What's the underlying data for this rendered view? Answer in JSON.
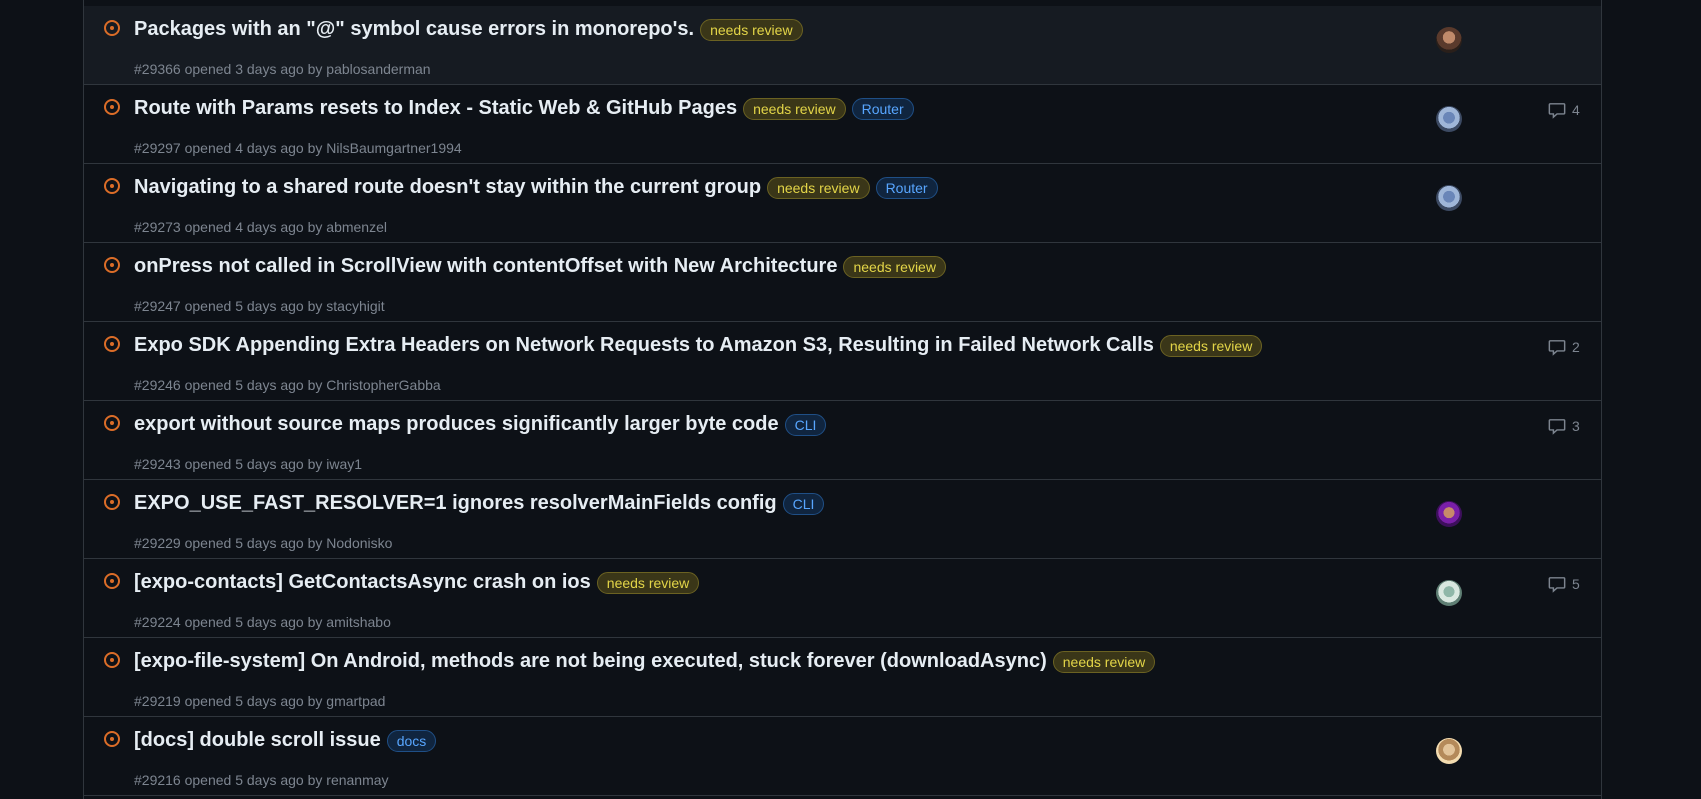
{
  "colors": {
    "background": "#0d1117",
    "row_hover": "#161b22",
    "border": "#30363d",
    "open_icon": "#db6d28",
    "muted_text": "#7d8590"
  },
  "labels": {
    "needs review": {
      "text": "needs review",
      "fg": "#e3d548",
      "bg": "#3a3618",
      "border": "#6b6222"
    },
    "Router": {
      "text": "Router",
      "fg": "#58a6ff",
      "bg": "#10253f",
      "border": "#1f4f86"
    },
    "CLI": {
      "text": "CLI",
      "fg": "#58a6ff",
      "bg": "#10253f",
      "border": "#1f4f86"
    },
    "docs": {
      "text": "docs",
      "fg": "#58a6ff",
      "bg": "#10253f",
      "border": "#1f4f86"
    }
  },
  "issues": [
    {
      "title": "Packages with an \"@\" symbol cause errors in monorepo's.",
      "labels": [
        "needs review"
      ],
      "meta_prefix": "#29366 opened 3 days ago by ",
      "author": "pablosanderman",
      "assignee_avatar": "avatar-photo-1",
      "comments": "",
      "highlight": true
    },
    {
      "title": "Route with Params resets to Index - Static Web & GitHub Pages",
      "labels": [
        "needs review",
        "Router"
      ],
      "meta_prefix": "#29297 opened 4 days ago by ",
      "author": "NilsBaumgartner1994",
      "assignee_avatar": "avatar-photo-2",
      "comments": "4"
    },
    {
      "title": "Navigating to a shared route doesn't stay within the current group",
      "labels": [
        "needs review",
        "Router"
      ],
      "meta_prefix": "#29273 opened 4 days ago by ",
      "author": "abmenzel",
      "assignee_avatar": "avatar-photo-2",
      "comments": ""
    },
    {
      "title": "onPress not called in ScrollView with contentOffset with New Architecture",
      "labels": [
        "needs review"
      ],
      "meta_prefix": "#29247 opened 5 days ago by ",
      "author": "stacyhigit",
      "assignee_avatar": "",
      "comments": ""
    },
    {
      "title": "Expo SDK Appending Extra Headers on Network Requests to Amazon S3, Resulting in Failed Network Calls",
      "labels": [
        "needs review"
      ],
      "meta_prefix": "#29246 opened 5 days ago by ",
      "author": "ChristopherGabba",
      "assignee_avatar": "",
      "comments": "2"
    },
    {
      "title": "export without source maps produces significantly larger byte code",
      "labels": [
        "CLI"
      ],
      "meta_prefix": "#29243 opened 5 days ago by ",
      "author": "iway1",
      "assignee_avatar": "",
      "comments": "3"
    },
    {
      "title": "EXPO_USE_FAST_RESOLVER=1 ignores resolverMainFields config",
      "labels": [
        "CLI"
      ],
      "meta_prefix": "#29229 opened 5 days ago by ",
      "author": "Nodonisko",
      "assignee_avatar": "avatar-photo-3",
      "comments": ""
    },
    {
      "title": "[expo-contacts] GetContactsAsync crash on ios",
      "labels": [
        "needs review"
      ],
      "meta_prefix": "#29224 opened 5 days ago by ",
      "author": "amitshabo",
      "assignee_avatar": "avatar-photo-4",
      "comments": "5"
    },
    {
      "title": "[expo-file-system] On Android, methods are not being executed, stuck forever (downloadAsync)",
      "labels": [
        "needs review"
      ],
      "meta_prefix": "#29219 opened 5 days ago by ",
      "author": "gmartpad",
      "assignee_avatar": "",
      "comments": ""
    },
    {
      "title": "[docs] double scroll issue",
      "labels": [
        "docs"
      ],
      "meta_prefix": "#29216 opened 5 days ago by ",
      "author": "renanmay",
      "assignee_avatar": "avatar-photo-5",
      "comments": ""
    }
  ]
}
